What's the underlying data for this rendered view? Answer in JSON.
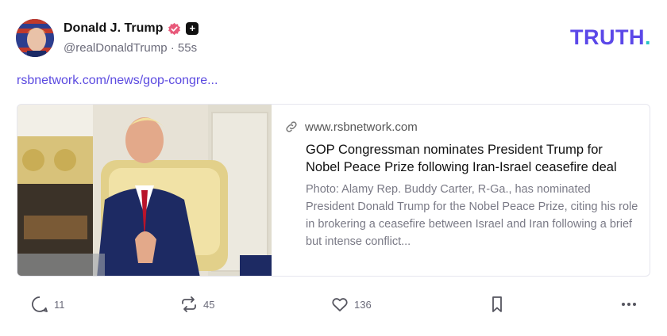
{
  "post": {
    "author": {
      "display_name": "Donald J. Trump",
      "handle": "@realDonaldTrump",
      "time_ago": "55s",
      "verified_color": "#e8597a"
    },
    "brand": {
      "logo_text": "TRUTH",
      "logo_dot": ".",
      "color": "#5b48e8",
      "dot_color": "#27c4c4"
    },
    "link_text": "rsbnetwork.com/news/gop-congre...",
    "card": {
      "domain": "www.rsbnetwork.com",
      "title": "GOP Congressman nominates President Trump for Nobel Peace Prize following Iran-Israel ceasefire deal",
      "description": "Photo: Alamy Rep. Buddy Carter, R-Ga., has nominated President Donald Trump for the Nobel Peace Prize, citing his role in brokering a ceasefire between Israel and Iran following a brief but intense conflict..."
    },
    "actions": {
      "replies": "11",
      "retruths": "45",
      "likes": "136"
    }
  }
}
